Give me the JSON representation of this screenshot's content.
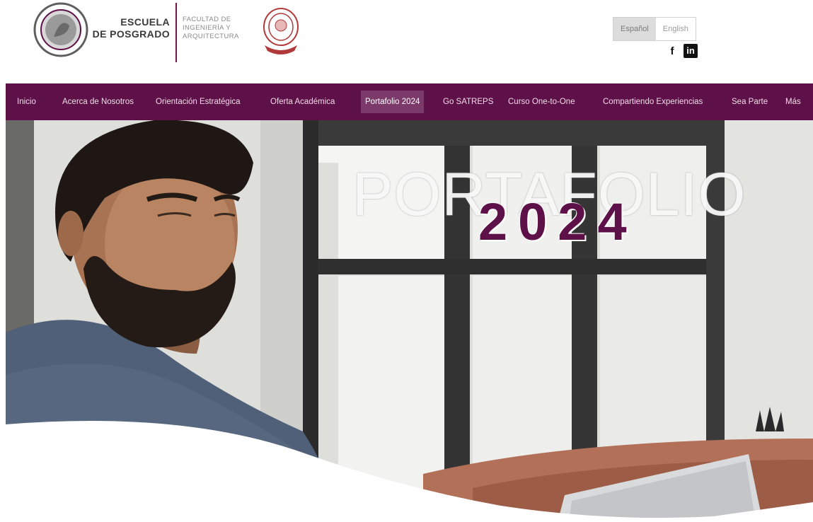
{
  "header": {
    "brand_line1": "ESCUELA",
    "brand_line2": "DE POSGRADO",
    "faculty_line1": "FACULTAD DE",
    "faculty_line2": "INGENIERÍA Y",
    "faculty_line3": "ARQUITECTURA",
    "lang_es": "Español",
    "lang_en": "English",
    "facebook_icon": "facebook-icon",
    "linkedin_icon": "linkedin-icon"
  },
  "nav": {
    "items": [
      {
        "label": "Inicio"
      },
      {
        "label": "Acerca de Nosotros"
      },
      {
        "label": "Orientación Estratégica"
      },
      {
        "label": "Oferta Académica"
      },
      {
        "label": "Portafolio 2024",
        "active": true
      },
      {
        "label": "Go SATREPS"
      },
      {
        "label": "Curso One-to-One"
      },
      {
        "label": "Compartiendo Experiencias"
      },
      {
        "label": "Sea Parte"
      },
      {
        "label": "Más"
      }
    ]
  },
  "hero": {
    "title": "PORTAFOLIO",
    "year": "2024"
  },
  "colors": {
    "brand": "#5e1148",
    "nav_active": "#7c3a6a"
  }
}
